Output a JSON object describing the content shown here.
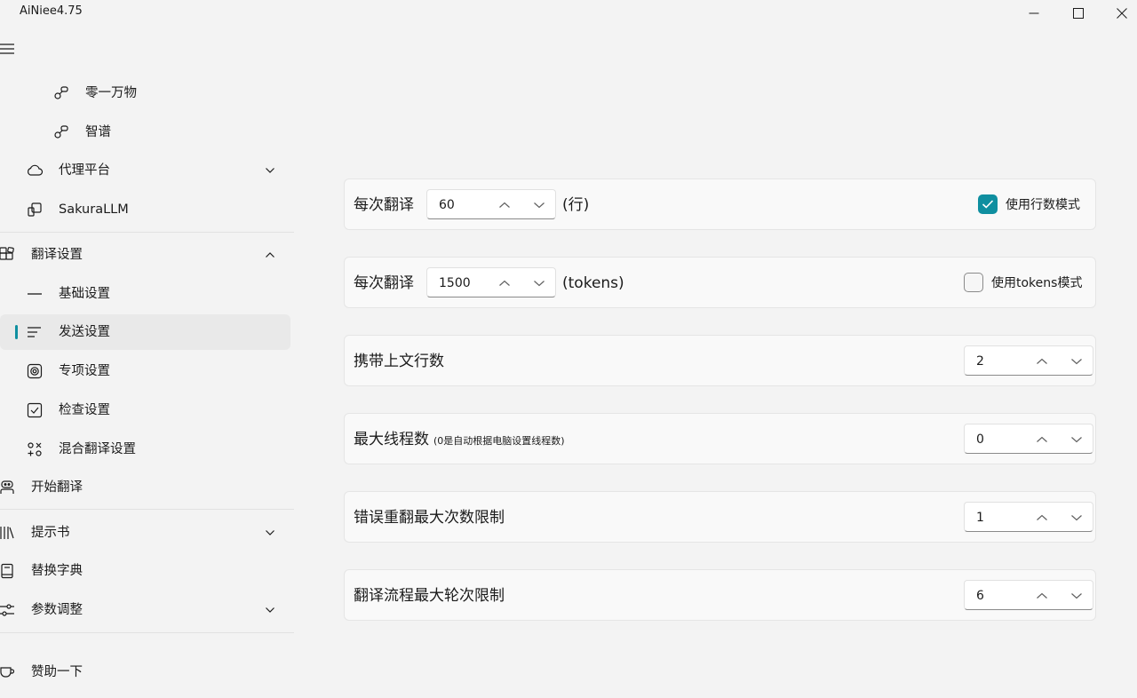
{
  "window": {
    "title": "AiNiee4.75"
  },
  "sidebar": {
    "items": [
      {
        "id": "lingyi",
        "label": "零一万物",
        "icon": "api-nodes-icon"
      },
      {
        "id": "zhipu",
        "label": "智谱",
        "icon": "api-nodes-icon"
      },
      {
        "id": "proxy",
        "label": "代理平台",
        "icon": "cloud-icon",
        "expanded": false
      },
      {
        "id": "sakura",
        "label": "SakuraLLM",
        "icon": "devices-icon"
      },
      {
        "id": "translate-settings",
        "label": "翻译设置",
        "icon": "apps-icon",
        "expanded": true
      },
      {
        "id": "basic",
        "label": "基础设置",
        "icon": "dash-icon"
      },
      {
        "id": "send",
        "label": "发送设置",
        "icon": "list-icon",
        "selected": true
      },
      {
        "id": "special",
        "label": "专项设置",
        "icon": "target-icon"
      },
      {
        "id": "check",
        "label": "检查设置",
        "icon": "checkbox-icon"
      },
      {
        "id": "mixed",
        "label": "混合翻译设置",
        "icon": "mix-icon"
      },
      {
        "id": "start",
        "label": "开始翻译",
        "icon": "robot-icon"
      },
      {
        "id": "prompt-book",
        "label": "提示书",
        "icon": "library-icon",
        "expanded": false
      },
      {
        "id": "dictionary",
        "label": "替换字典",
        "icon": "book-icon"
      },
      {
        "id": "params",
        "label": "参数调整",
        "icon": "sliders-icon",
        "expanded": false
      },
      {
        "id": "donate",
        "label": "赞助一下",
        "icon": "cup-icon"
      }
    ]
  },
  "settings": {
    "lines_per_translation": {
      "label": "每次翻译",
      "value": "60",
      "unit": "(行)",
      "mode_label": "使用行数模式",
      "mode_checked": true
    },
    "tokens_per_translation": {
      "label": "每次翻译",
      "value": "1500",
      "unit": "(tokens)",
      "mode_label": "使用tokens模式",
      "mode_checked": false
    },
    "context_lines": {
      "label": "携带上文行数",
      "value": "2"
    },
    "max_threads": {
      "label": "最大线程数",
      "note": "(0是自动根据电脑设置线程数)",
      "value": "0"
    },
    "retry_limit": {
      "label": "错误重翻最大次数限制",
      "value": "1"
    },
    "round_limit": {
      "label": "翻译流程最大轮次限制",
      "value": "6"
    }
  },
  "colors": {
    "accent": "#0f8fa0",
    "background": "#f3f3f3",
    "card": "#f9f9f9"
  }
}
